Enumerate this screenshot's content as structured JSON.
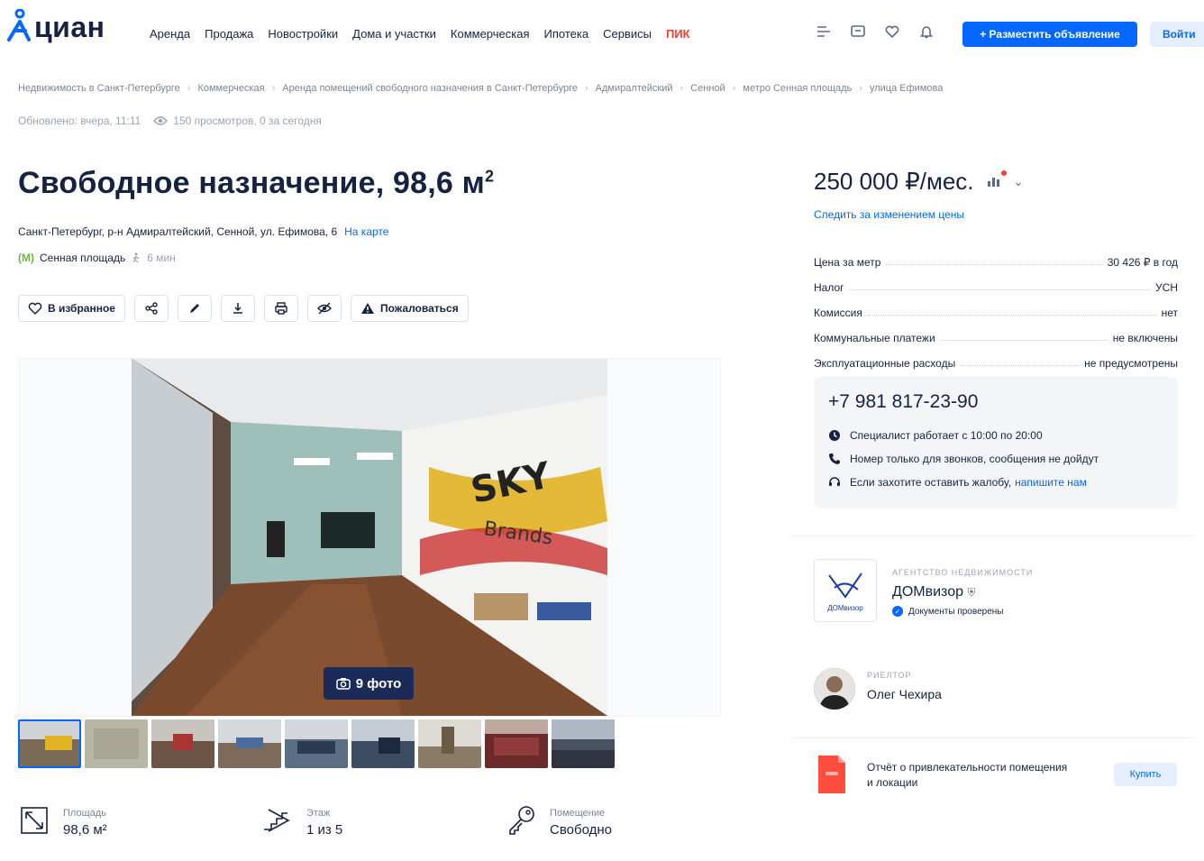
{
  "header": {
    "logo_text": "циан",
    "nav": [
      "Аренда",
      "Продажа",
      "Новостройки",
      "Дома и участки",
      "Коммерческая",
      "Ипотека",
      "Сервисы"
    ],
    "pik_label": "ПИК",
    "post_button": "+ Разместить объявление",
    "login_button": "Войти"
  },
  "breadcrumbs": [
    "Недвижимость в Санкт-Петербурге",
    "Коммерческая",
    "Аренда помещений свободного назначения в Санкт-Петербурге",
    "Адмиралтейский",
    "Сенной",
    "метро Сенная площадь",
    "улица Ефимова"
  ],
  "meta": {
    "updated": "Обновлено: вчера, 11:11",
    "views": "150 просмотров, 0 за сегодня"
  },
  "listing": {
    "title": "Свободное назначение, 98,6 м",
    "title_sup": "2",
    "address": "Санкт-Петербург, р-н Адмиралтейский, Сенной, ул. Ефимова, 6",
    "map_link": "На карте",
    "metro_icon": "(M)",
    "metro": "Сенная площадь",
    "walk_time": "6 мин"
  },
  "actions": {
    "favorite": "В избранное",
    "complain": "Пожаловаться"
  },
  "gallery": {
    "photo_count": "9 фото",
    "thumbnail_count": 9
  },
  "params": [
    {
      "label": "Площадь",
      "value": "98,6 м²",
      "icon": "area-icon"
    },
    {
      "label": "Этаж",
      "value": "1 из 5",
      "icon": "stairs-icon"
    },
    {
      "label": "Помещение",
      "value": "Свободно",
      "icon": "key-icon"
    }
  ],
  "price": {
    "value": "250 000 ₽/мес.",
    "follow_link": "Следить за изменением цены",
    "rows": [
      {
        "label": "Цена за метр",
        "value": "30 426 ₽ в год"
      },
      {
        "label": "Налог",
        "value": "УСН"
      },
      {
        "label": "Комиссия",
        "value": "нет"
      },
      {
        "label": "Коммунальные платежи",
        "value": "не включены"
      },
      {
        "label": "Эксплуатационные расходы",
        "value": "не предусмотрены"
      }
    ]
  },
  "contact": {
    "phone": "+7 981 817-23-90",
    "hours": "Специалист работает с 10:00 по 20:00",
    "calls_only": "Номер только для звонков, сообщения не дойдут",
    "complaint_text": "Если захотите оставить жалобу,",
    "complaint_link": "напишите нам"
  },
  "agency": {
    "kind": "АГЕНТСТВО НЕДВИЖИМОСТИ",
    "name": "ДОМвизор",
    "verified": "Документы проверены",
    "logo_caption": "ДОМвизор"
  },
  "realtor": {
    "kind": "РИЕЛТОР",
    "name": "Олег Чехира"
  },
  "report": {
    "text": "Отчёт о привлекательности помещения и локации",
    "buy": "Купить"
  },
  "colors": {
    "brand_blue": "#0468ff",
    "text_dark": "#152242",
    "pik_red": "#ff3b30",
    "badge_navy": "#1b2a56"
  }
}
